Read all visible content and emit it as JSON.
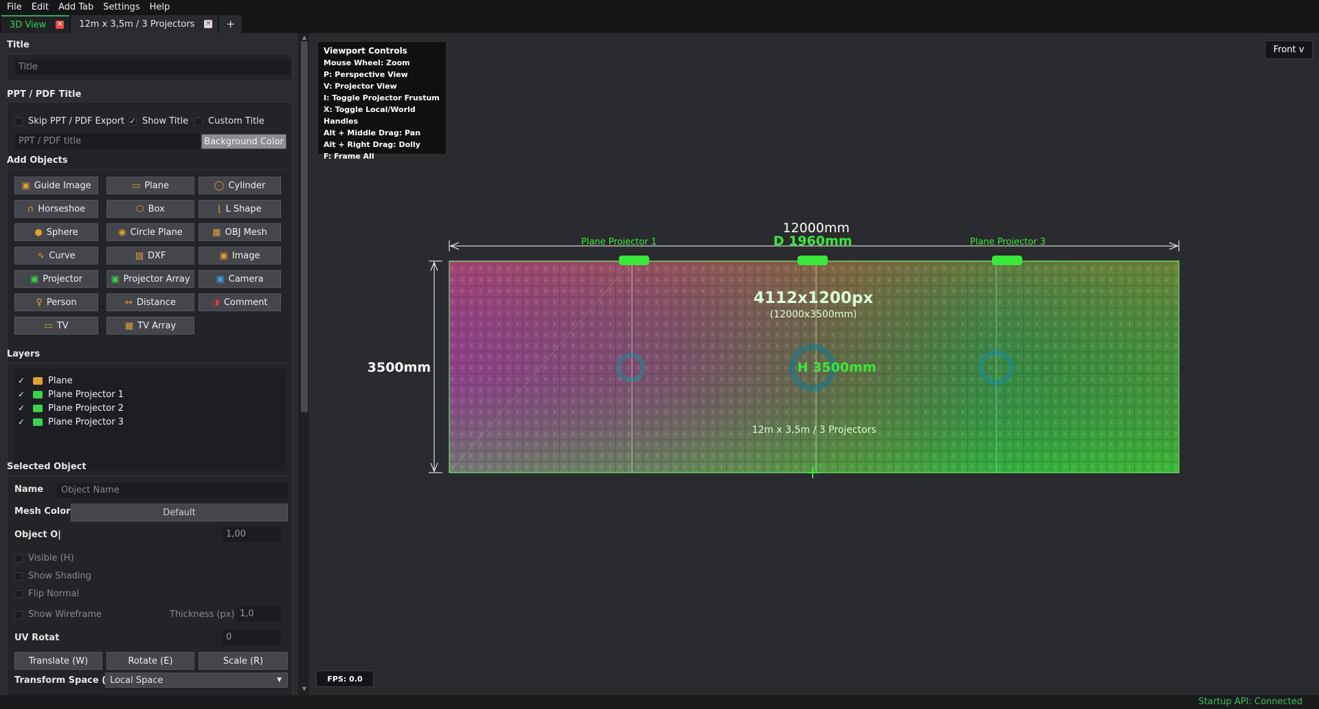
{
  "menu": [
    "File",
    "Edit",
    "Add Tab",
    "Settings",
    "Help"
  ],
  "tabs": [
    {
      "label": "3D View",
      "active": true
    },
    {
      "label": "12m x 3,5m / 3 Projectors",
      "active": false
    }
  ],
  "tab_add": "+",
  "panel": {
    "title_section": "Title",
    "title_placeholder": "Title",
    "ppt_section": "PPT / PDF Title",
    "skip_ppt": "Skip PPT / PDF Export",
    "show_title": "Show Title",
    "custom_title": "Custom Title",
    "ppt_placeholder": "PPT / PDF title",
    "bg_color": "Background Color",
    "add_objects": "Add Objects",
    "buttons": [
      {
        "label": "Guide Image",
        "icon": "image-icon",
        "color": "#e0a030"
      },
      {
        "label": "Plane",
        "icon": "plane-icon",
        "color": "#e0a030"
      },
      {
        "label": "Cylinder",
        "icon": "cylinder-icon",
        "color": "#e0a030"
      },
      {
        "label": "Horseshoe",
        "icon": "horseshoe-icon",
        "color": "#e0a030"
      },
      {
        "label": "Box",
        "icon": "box-icon",
        "color": "#e0a030"
      },
      {
        "label": "L Shape",
        "icon": "l-shape-icon",
        "color": "#e0a030"
      },
      {
        "label": "Sphere",
        "icon": "sphere-icon",
        "color": "#e0a030"
      },
      {
        "label": "Circle Plane",
        "icon": "circle-plane-icon",
        "color": "#e0a030"
      },
      {
        "label": "OBJ Mesh",
        "icon": "obj-mesh-icon",
        "color": "#e0a030"
      },
      {
        "label": "Curve",
        "icon": "curve-icon",
        "color": "#e0a030"
      },
      {
        "label": "DXF",
        "icon": "dxf-icon",
        "color": "#e0a030"
      },
      {
        "label": "Image",
        "icon": "image-icon",
        "color": "#e0a030"
      },
      {
        "label": "Projector",
        "icon": "projector-icon",
        "color": "#3ad34d"
      },
      {
        "label": "Projector Array",
        "icon": "projector-array-icon",
        "color": "#3ad34d"
      },
      {
        "label": "Camera",
        "icon": "camera-icon",
        "color": "#3aa0e0"
      },
      {
        "label": "Person",
        "icon": "person-icon",
        "color": "#e0a030"
      },
      {
        "label": "Distance",
        "icon": "distance-icon",
        "color": "#e0a030"
      },
      {
        "label": "Comment",
        "icon": "comment-icon",
        "color": "#e03a3a"
      },
      {
        "label": "TV",
        "icon": "tv-icon",
        "color": "#e0a030"
      },
      {
        "label": "TV Array",
        "icon": "tv-array-icon",
        "color": "#e0a030"
      }
    ],
    "layers_section": "Layers",
    "layers": [
      {
        "label": "Plane",
        "icon": "plane-icon",
        "color": "#e0a030"
      },
      {
        "label": "Plane Projector 1",
        "icon": "projector-icon",
        "color": "#3ad34d"
      },
      {
        "label": "Plane Projector 2",
        "icon": "projector-icon",
        "color": "#3ad34d"
      },
      {
        "label": "Plane Projector 3",
        "icon": "projector-icon",
        "color": "#3ad34d"
      }
    ],
    "selected_section": "Selected Object",
    "name_label": "Name",
    "name_placeholder": "Object Name",
    "mesh_color_label": "Mesh Color",
    "mesh_color_value": "Default",
    "opacity_label": "Object O|",
    "opacity_value": "1,00",
    "visible": "Visible (H)",
    "show_shading": "Show Shading",
    "flip_normal": "Flip Normal",
    "show_wireframe": "Show Wireframe",
    "thickness_label": "Thickness (px)",
    "thickness_value": "1,0",
    "uv_label": "UV Rotat",
    "uv_value": "0",
    "translate": "Translate (W)",
    "rotate": "Rotate (E)",
    "scale": "Scale (R)",
    "transform_space_label": "Transform Space (X)",
    "transform_space_value": "Local Space"
  },
  "viewport": {
    "controls_title": "Viewport Controls",
    "controls": [
      "Mouse Wheel: Zoom",
      "P: Perspective View",
      "V: Projector View",
      "I: Toggle Projector Frustum",
      "X: Toggle Local/World Handles",
      "Alt + Middle Drag: Pan",
      "Alt + Right Drag: Dolly",
      "F: Frame All"
    ],
    "view_dropdown": "Front v",
    "fps": "FPS: 0.0",
    "width_dim": "12000mm",
    "depth_dim": "D 1960mm",
    "height_dim": "3500mm",
    "resolution": "4112x1200px",
    "resolution_mm": "(12000x3500mm)",
    "center_height": "H 3500mm",
    "plane_label": "12m x 3,5m / 3 Projectors",
    "projector_labels": [
      "Plane Projector 1",
      "",
      "Plane Projector 3"
    ],
    "axis_label": "Y",
    "colors": {
      "accent": "#39d353",
      "dim_line": "#ffffff"
    }
  },
  "status": "Startup API: Connected"
}
